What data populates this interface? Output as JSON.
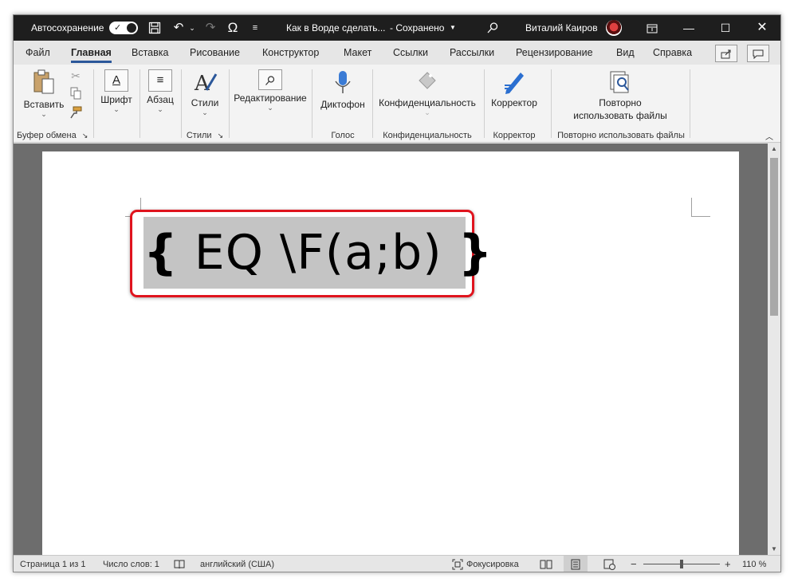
{
  "titlebar": {
    "autosave_label": "Автосохранение",
    "doc_title": "Как в Ворде сделать...",
    "save_status": "- Сохранено",
    "user_name": "Виталий Каиров",
    "icons": [
      "save-icon",
      "undo-icon",
      "redo-icon",
      "omega-icon",
      "customize-icon",
      "search-icon",
      "ribbon-display-icon",
      "minimize-icon",
      "maximize-icon",
      "close-icon"
    ]
  },
  "tabs": [
    {
      "label": "Файл"
    },
    {
      "label": "Главная"
    },
    {
      "label": "Вставка"
    },
    {
      "label": "Рисование"
    },
    {
      "label": "Конструктор"
    },
    {
      "label": "Макет"
    },
    {
      "label": "Ссылки"
    },
    {
      "label": "Рассылки"
    },
    {
      "label": "Рецензирование"
    },
    {
      "label": "Вид"
    },
    {
      "label": "Справка"
    }
  ],
  "active_tab": "Главная",
  "ribbon": {
    "paste": "Вставить",
    "clipboard_group": "Буфер обмена",
    "font": "Шрифт",
    "paragraph": "Абзац",
    "styles": "Стили",
    "styles_group": "Стили",
    "editing": "Редактирование",
    "dictate": "Диктофон",
    "voice_group": "Голос",
    "sensitivity": "Конфиденциальность",
    "sensitivity_group": "Конфиденциальность",
    "editor": "Корректор",
    "editor_group": "Корректор",
    "reuse_line1": "Повторно",
    "reuse_line2": "использовать файлы",
    "reuse_group": "Повторно использовать файлы"
  },
  "document": {
    "field_open": "{",
    "field_code": " EQ \\F(a;b) ",
    "field_close": "}",
    "highlight_color": "#e0141e"
  },
  "statusbar": {
    "page": "Страница 1 из 1",
    "words": "Число слов: 1",
    "language": "английский (США)",
    "focus": "Фокусировка",
    "zoom_minus": "−",
    "zoom_plus": "+",
    "zoom": "110 %"
  },
  "colors": {
    "titlebar": "#1e1e1e",
    "accent": "#2b579a",
    "selection": "#c4c4c4"
  }
}
